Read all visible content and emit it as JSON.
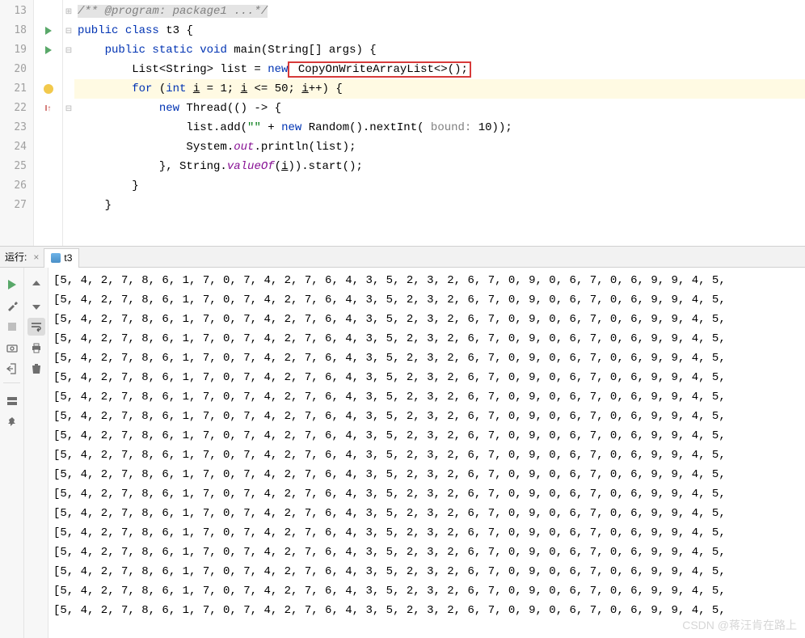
{
  "editor": {
    "lines": [
      {
        "n": 13,
        "mark": "",
        "fold": "⊞",
        "tokens": [
          {
            "t": "/** @program: package1 ...*/",
            "c": "cm"
          }
        ],
        "hl": false
      },
      {
        "n": 18,
        "mark": "run",
        "fold": "⊟",
        "tokens": [
          {
            "t": "public ",
            "c": "kw"
          },
          {
            "t": "class ",
            "c": "kw"
          },
          {
            "t": "t3 {",
            "c": "ty"
          }
        ],
        "hl": false
      },
      {
        "n": 19,
        "mark": "run",
        "fold": "⊟",
        "tokens": [
          {
            "t": "    public static ",
            "c": "kw"
          },
          {
            "t": "void ",
            "c": "kw"
          },
          {
            "t": "main",
            "c": "fn"
          },
          {
            "t": "(String[] args) {",
            "c": "ty"
          }
        ],
        "hl": false
      },
      {
        "n": 20,
        "mark": "",
        "fold": "",
        "tokens": [
          {
            "t": "        List<String> list = ",
            "c": "ty"
          },
          {
            "t": "new",
            "c": "kw"
          },
          {
            "t": " CopyOnWriteArrayList<>();",
            "c": "ty",
            "box": true
          }
        ],
        "hl": false
      },
      {
        "n": 21,
        "mark": "bulb",
        "fold": "",
        "tokens": [
          {
            "t": "        for ",
            "c": "kw"
          },
          {
            "t": "(",
            "c": "ty"
          },
          {
            "t": "int ",
            "c": "kw"
          },
          {
            "t": "i",
            "c": "ty",
            "u": true
          },
          {
            "t": " = ",
            "c": "ty"
          },
          {
            "t": "1",
            "c": "ty"
          },
          {
            "t": "; ",
            "c": "ty"
          },
          {
            "t": "i",
            "c": "ty",
            "u": true
          },
          {
            "t": " <= ",
            "c": "ty"
          },
          {
            "t": "50",
            "c": "ty"
          },
          {
            "t": "; ",
            "c": "ty"
          },
          {
            "t": "i",
            "c": "ty",
            "u": true
          },
          {
            "t": "++) {",
            "c": "ty"
          }
        ],
        "hl": true
      },
      {
        "n": 22,
        "mark": "redup",
        "fold": "⊟",
        "tokens": [
          {
            "t": "            new ",
            "c": "kw"
          },
          {
            "t": "Thread(() -> {",
            "c": "ty"
          }
        ],
        "hl": false
      },
      {
        "n": 23,
        "mark": "",
        "fold": "",
        "tokens": [
          {
            "t": "                list.add(",
            "c": "ty"
          },
          {
            "t": "\"\"",
            "c": "st"
          },
          {
            "t": " + ",
            "c": "ty"
          },
          {
            "t": "new ",
            "c": "kw"
          },
          {
            "t": "Random().nextInt(",
            "c": "ty"
          },
          {
            "t": " bound: ",
            "c": "pa"
          },
          {
            "t": "10",
            "c": "ty"
          },
          {
            "t": "));",
            "c": "ty"
          }
        ],
        "hl": false
      },
      {
        "n": 24,
        "mark": "",
        "fold": "",
        "tokens": [
          {
            "t": "                System.",
            "c": "ty"
          },
          {
            "t": "out",
            "c": "stat"
          },
          {
            "t": ".println(list);",
            "c": "ty"
          }
        ],
        "hl": false
      },
      {
        "n": 25,
        "mark": "",
        "fold": "",
        "tokens": [
          {
            "t": "            }, String.",
            "c": "ty"
          },
          {
            "t": "valueOf",
            "c": "stat"
          },
          {
            "t": "(",
            "c": "ty"
          },
          {
            "t": "i",
            "c": "ty",
            "u": true
          },
          {
            "t": ")).start();",
            "c": "ty"
          }
        ],
        "hl": false
      },
      {
        "n": 26,
        "mark": "",
        "fold": "",
        "tokens": [
          {
            "t": "        }",
            "c": "ty"
          }
        ],
        "hl": false
      },
      {
        "n": 27,
        "mark": "",
        "fold": "",
        "tokens": [
          {
            "t": "    }",
            "c": "ty"
          }
        ],
        "hl": false
      }
    ]
  },
  "run": {
    "label": "运行:",
    "tab": "t3",
    "row": "[5, 4, 2, 7, 8, 6, 1, 7, 0, 7, 4, 2, 7, 6, 4, 3, 5, 2, 3, 2, 6, 7, 0, 9, 0, 6, 7, 0, 6, 9, 9, 4, 5,",
    "count": 18
  },
  "watermark": "CSDN @蒋汪肯在路上"
}
